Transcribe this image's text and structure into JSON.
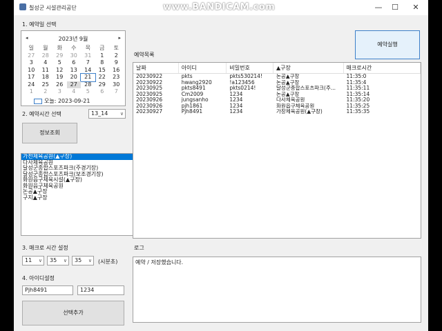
{
  "window": {
    "title": "칠성군 시설관리공단",
    "watermark": "www.BANDICAM.com",
    "minimize": "—",
    "maximize": "☐",
    "close": "✕"
  },
  "sections": {
    "date_label": "1. 예약일 선택",
    "time_label": "2. 예약시간 선택",
    "macro_label": "3. 매크로 시간 설정",
    "id_label": "4. 아이디설정",
    "list_label": "예약목록",
    "log_label": "로그"
  },
  "calendar": {
    "header": "2023년 9월",
    "prev": "◂",
    "next": "▸",
    "weekdays": [
      "일",
      "월",
      "화",
      "수",
      "목",
      "금",
      "토"
    ],
    "weeks": [
      [
        "27",
        "28",
        "29",
        "30",
        "31",
        "1",
        "2"
      ],
      [
        "3",
        "4",
        "5",
        "6",
        "7",
        "8",
        "9"
      ],
      [
        "10",
        "11",
        "12",
        "13",
        "14",
        "15",
        "16"
      ],
      [
        "17",
        "18",
        "19",
        "20",
        "21",
        "22",
        "23"
      ],
      [
        "24",
        "25",
        "26",
        "27",
        "28",
        "29",
        "30"
      ],
      [
        "1",
        "2",
        "3",
        "4",
        "5",
        "6",
        "7"
      ]
    ],
    "today_label": "오늘: 2023-09-21"
  },
  "time_select": {
    "value": "13_14"
  },
  "buttons": {
    "info_lookup": "정보조회",
    "reserve_run": "예약실행",
    "select_add": "선택추가"
  },
  "facilities": [
    "가천체육공원(▲구장)",
    "다사체육공원",
    "달성군종합스포츠파크(주경기장)",
    "달성군종합스포츠파크(보조경기장)",
    "화원읍구체육시설(▲구장)",
    "화원읍구체육공원",
    "논공▲구장",
    "구지▲구장"
  ],
  "reservation_table": {
    "headers": [
      "날짜",
      "아이디",
      "비밀번호",
      "▲구장",
      "매크로시간"
    ],
    "rows": [
      [
        "20230922",
        "pkts",
        "pkts530214!",
        "논공▲구장",
        "11:35:0"
      ],
      [
        "20230922",
        "hwang2920",
        "!a123456",
        "논공▲구장",
        "11:35:4"
      ],
      [
        "20230925",
        "pkts8491",
        "pkts0214!",
        "달성군종합스포츠파크(주...",
        "11:35:11"
      ],
      [
        "20230925",
        "Cm2009",
        "1234",
        "논공▲구장",
        "11:35:14"
      ],
      [
        "20230926",
        "jungsanho",
        "1234",
        "다사체육공원",
        "11:35:20"
      ],
      [
        "20230926",
        "pjh1861",
        "1234",
        "화원읍구체육공원",
        "11:35:25"
      ],
      [
        "20230927",
        "Pjh8491",
        "1234",
        "가창체육공원(▲구장)",
        "11:35:35"
      ]
    ]
  },
  "macro_time": {
    "hour": "11",
    "minute": "35",
    "second": "35",
    "unit_label": "(시분초)"
  },
  "account": {
    "id": "Pjh8491",
    "password": "1234"
  },
  "log": {
    "text": "예약 / 저장했습니다."
  }
}
